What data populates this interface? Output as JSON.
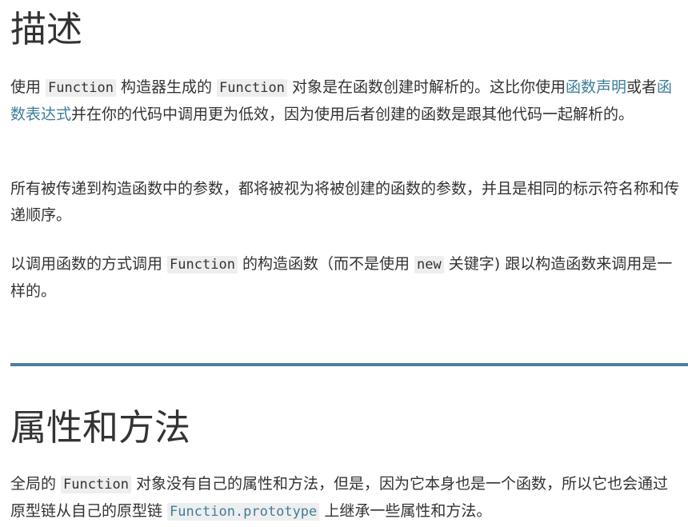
{
  "section1": {
    "heading": "描述",
    "para1": {
      "t1": "使用 ",
      "code1": "Function",
      "t2": " 构造器生成的 ",
      "code2": "Function",
      "t3": " 对象是在函数创建时解析的。这比你使用",
      "link1": "函数声明",
      "t4": "或者",
      "link2": "函数表达式",
      "t5": "并在你的代码中调用更为低效，因为使用后者创建的函数是跟其他代码一起解析的。"
    },
    "para2": "所有被传递到构造函数中的参数，都将被视为将被创建的函数的参数，并且是相同的标示符名称和传递顺序。",
    "para3": {
      "t1": "以调用函数的方式调用 ",
      "code1": "Function",
      "t2": " 的构造函数（而不是使用 ",
      "code2": "new",
      "t3": " 关键字) 跟以构造函数来调用是一样的。"
    }
  },
  "section2": {
    "heading": "属性和方法",
    "para1": {
      "t1": "全局的 ",
      "code1": "Function",
      "t2": " 对象没有自己的属性和方法，但是，因为它本身也是一个函数，所以它也会通过原型链从自己的原型链 ",
      "link1": "Function.prototype",
      "t3": " 上继承一些属性和方法。"
    }
  },
  "colors": {
    "text": "#333333",
    "link": "#3d7e9a",
    "rule": "#4d7e9e",
    "code_bg": "#eeeeee"
  }
}
